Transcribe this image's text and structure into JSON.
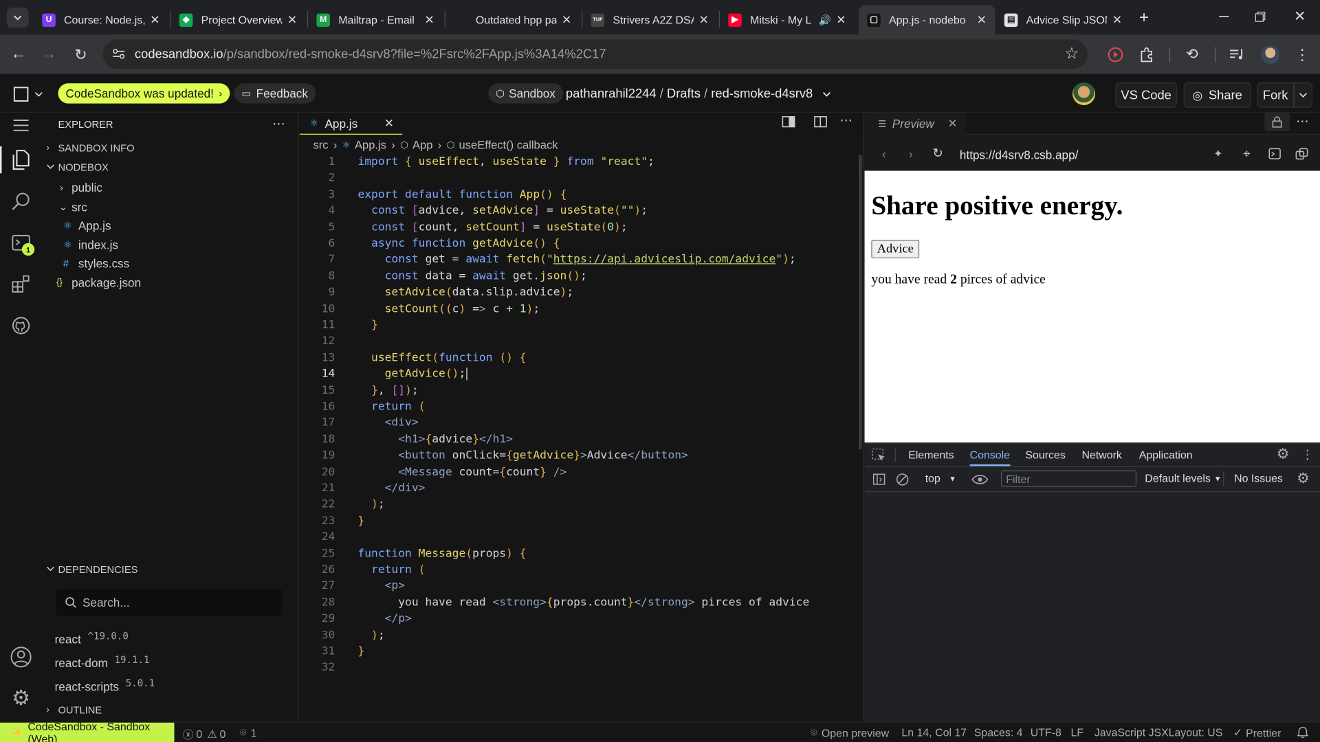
{
  "browser_tabs": [
    {
      "title": "Course: Node.js,",
      "favicon": "U",
      "color": "#7e3ff2"
    },
    {
      "title": "Project Overview",
      "favicon": "◆",
      "color": "#13aa52"
    },
    {
      "title": "Mailtrap - Email",
      "favicon": "M",
      "color": "#1aa34a"
    },
    {
      "title": "Outdated hpp pa",
      "favicon": "",
      "color": "#202124"
    },
    {
      "title": "Strivers A2Z DSA",
      "favicon": "TUF",
      "color": "#444"
    },
    {
      "title": "Mitski - My L",
      "favicon": "▶",
      "color": "#ff0033"
    },
    {
      "title": "App.js - nodebo",
      "favicon": "▢",
      "color": "#151515"
    },
    {
      "title": "Advice Slip JSON",
      "favicon": "▤",
      "color": "#e3e3e3"
    }
  ],
  "address": {
    "domain": "codesandbox.io",
    "path": "/p/sandbox/red-smoke-d4srv8?file=%2Fsrc%2FApp.js%3A14%2C17"
  },
  "header": {
    "updated": "CodeSandbox was updated!",
    "feedback": "Feedback",
    "sandbox": "Sandbox",
    "owner": "pathanrahil2244",
    "sep1": "/",
    "folder": "Drafts",
    "sep2": "/",
    "project": "red-smoke-d4srv8",
    "vscode": "VS Code",
    "share": "Share",
    "fork": "Fork"
  },
  "activity": {
    "badge": "1"
  },
  "sidebar": {
    "title": "EXPLORER",
    "sandbox_info": "SANDBOX INFO",
    "project": "NODEBOX",
    "tree": [
      {
        "label": "public",
        "type": "folder",
        "depth": 1
      },
      {
        "label": "src",
        "type": "folder-open",
        "depth": 1
      },
      {
        "label": "App.js",
        "type": "js",
        "depth": 2
      },
      {
        "label": "index.js",
        "type": "js",
        "depth": 2
      },
      {
        "label": "styles.css",
        "type": "css",
        "depth": 2
      },
      {
        "label": "package.json",
        "type": "json",
        "depth": 1
      }
    ],
    "dependencies_title": "DEPENDENCIES",
    "search_placeholder": "Search...",
    "deps": [
      {
        "name": "react",
        "version": "^19.0.0"
      },
      {
        "name": "react-dom",
        "version": "19.1.1"
      },
      {
        "name": "react-scripts",
        "version": "5.0.1"
      }
    ],
    "outline": "OUTLINE"
  },
  "editor": {
    "tab": "App.js",
    "breadcrumb": [
      "src",
      "App.js",
      "App",
      "useEffect() callback"
    ],
    "lines": [
      "import { useEffect, useState } from \"react\";",
      "",
      "export default function App() {",
      "  const [advice, setAdvice] = useState(\"\");",
      "  const [count, setCount] = useState(0);",
      "  async function getAdvice() {",
      "    const get = await fetch(\"https://api.adviceslip.com/advice\");",
      "    const data = await get.json();",
      "    setAdvice(data.slip.advice);",
      "    setCount((c) => c + 1);",
      "  }",
      "",
      "  useEffect(function () {",
      "    getAdvice();",
      "  }, []);",
      "  return (",
      "    <div>",
      "      <h1>{advice}</h1>",
      "      <button onClick={getAdvice}>Advice</button>",
      "      <Message count={count} />",
      "    </div>",
      "  );",
      "}",
      "",
      "function Message(props) {",
      "  return (",
      "    <p>",
      "      you have read <strong>{props.count}</strong> pirces of advice",
      "    </p>",
      "  );",
      "}",
      ""
    ],
    "current_line": 14
  },
  "preview": {
    "tab": "Preview",
    "url": "https://d4srv8.csb.app/",
    "heading": "Share positive energy.",
    "button": "Advice",
    "msg_before": "you have read",
    "msg_count": "2",
    "msg_after": "pirces of advice"
  },
  "devtools": {
    "tabs": [
      "Elements",
      "Console",
      "Sources",
      "Network",
      "Application"
    ],
    "active_tab": "Console",
    "context": "top",
    "filter_placeholder": "Filter",
    "levels": "Default levels",
    "issues": "No Issues"
  },
  "status": {
    "brand": "CodeSandbox - Sandbox (Web)",
    "errors": "0",
    "warnings": "0",
    "ports": "1",
    "open_preview": "Open preview",
    "position": "Ln 14, Col 17",
    "spaces": "Spaces: 4",
    "encoding": "UTF-8",
    "eol": "LF",
    "language": "JavaScript JSX",
    "layout": "Layout: US",
    "prettier": "Prettier"
  },
  "colors": {
    "accent": "#dcff50",
    "brand_green": "#c5f24a",
    "link": "#4fc1ff"
  }
}
